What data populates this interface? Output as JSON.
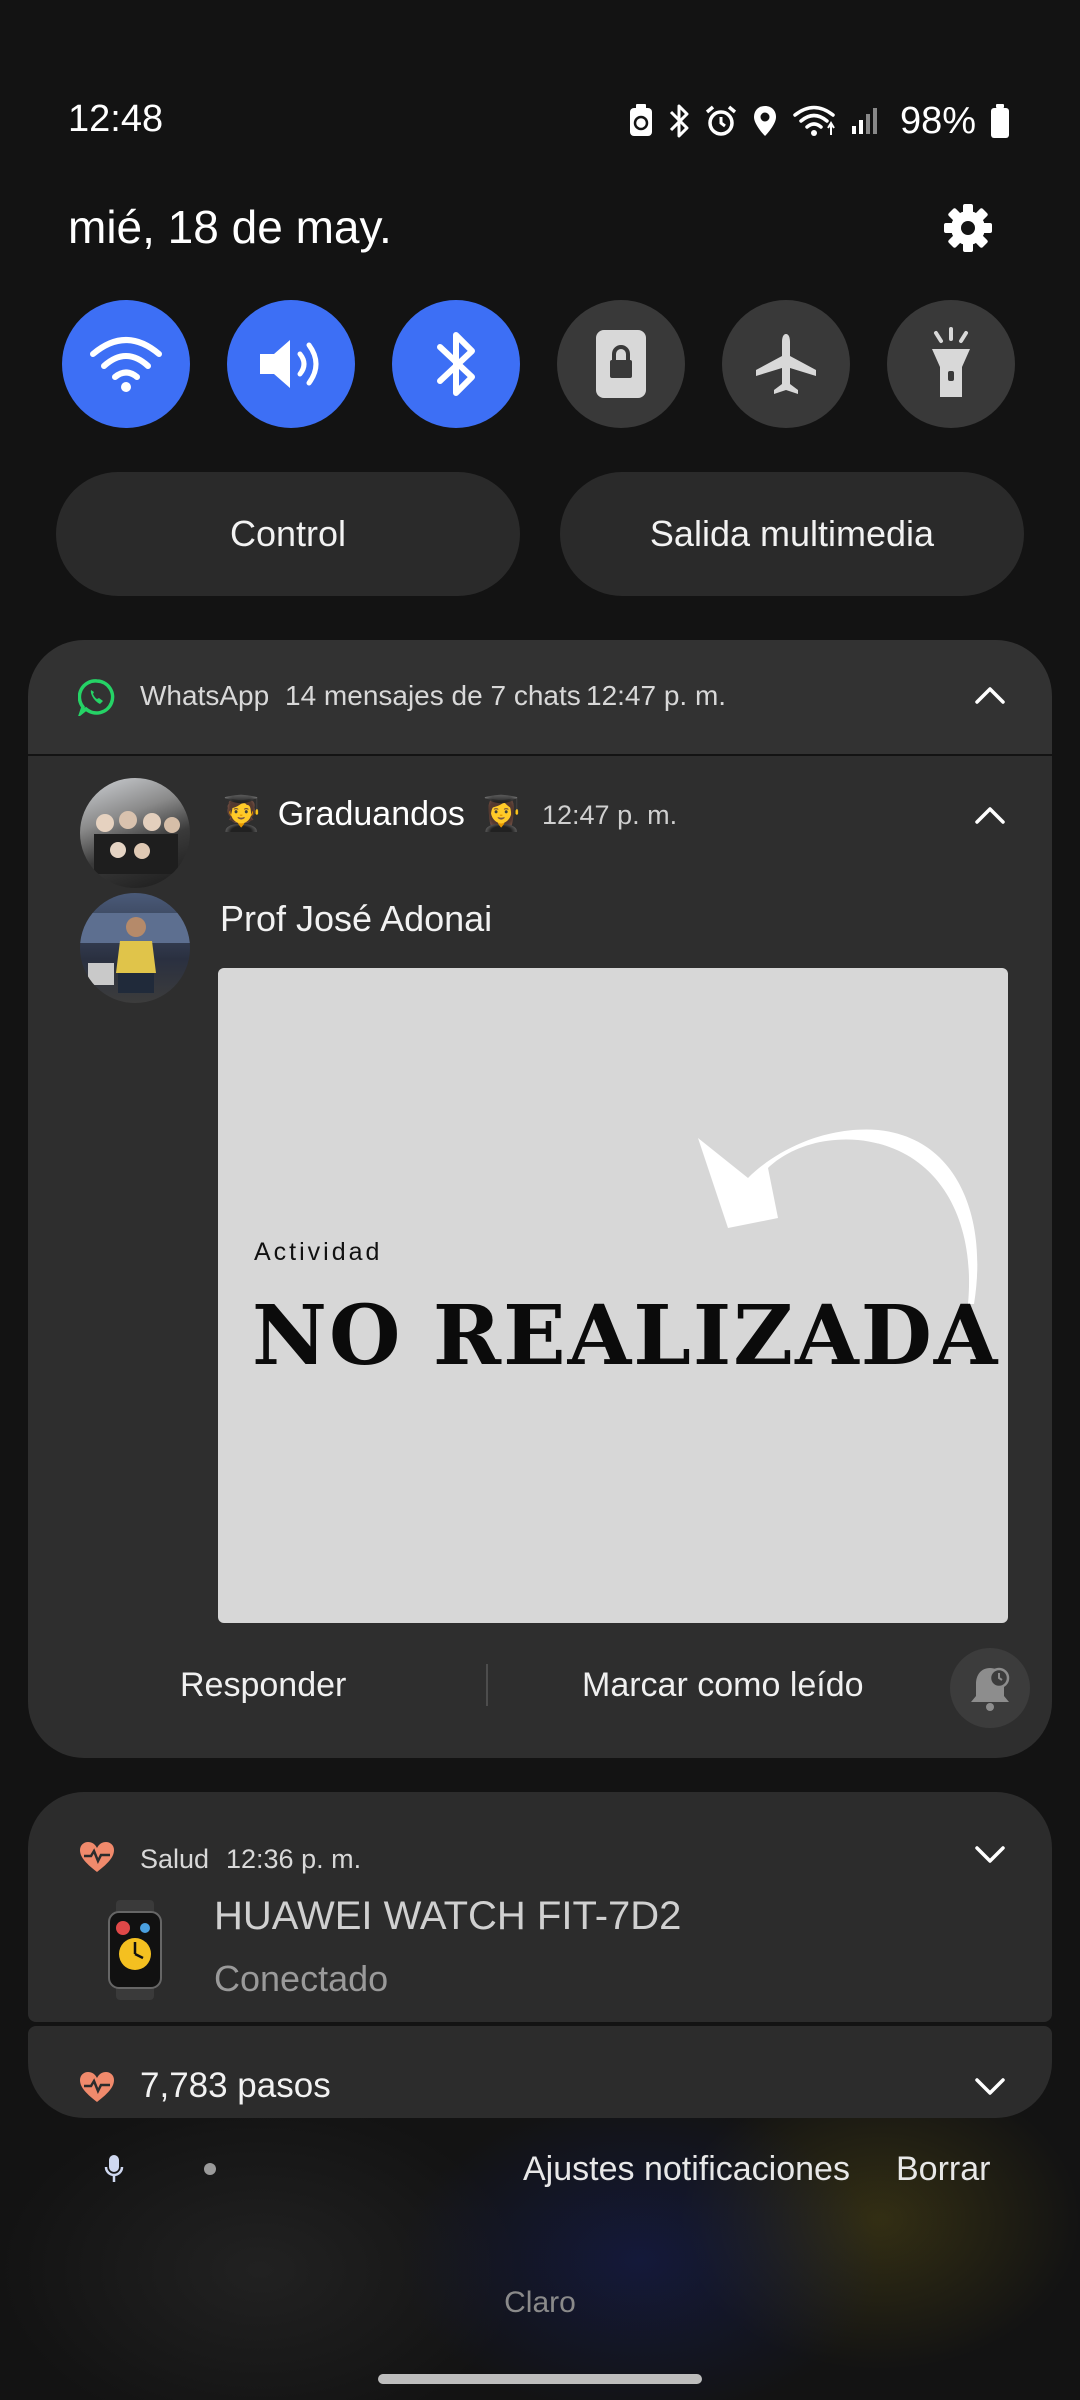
{
  "status_bar": {
    "time": "12:48",
    "battery": "98%"
  },
  "header": {
    "date": "mié, 18 de may."
  },
  "quick_settings": [
    {
      "name": "wifi",
      "icon": "wifi-icon",
      "on": true
    },
    {
      "name": "sound",
      "icon": "volume-icon",
      "on": true
    },
    {
      "name": "bluetooth",
      "icon": "bluetooth-icon",
      "on": true
    },
    {
      "name": "screen-lock",
      "icon": "lock-icon",
      "on": false
    },
    {
      "name": "airplane",
      "icon": "airplane-icon",
      "on": false
    },
    {
      "name": "flashlight",
      "icon": "flashlight-icon",
      "on": false
    }
  ],
  "pills": {
    "control": "Control",
    "media_output": "Salida multimedia"
  },
  "whatsapp": {
    "app": "WhatsApp",
    "summary": "14 mensajes de 7 chats",
    "time": "12:47 p. m.",
    "chat": {
      "title": "Graduandos",
      "emoji_left": "🧑‍🎓",
      "emoji_right": "👩‍🎓",
      "time": "12:47 p. m.",
      "sender": "Prof José Adonai",
      "image_small_text": "Actividad",
      "image_big_text": "NO REALIZADA"
    },
    "actions": {
      "reply": "Responder",
      "mark_read": "Marcar como leído"
    }
  },
  "salud": {
    "app": "Salud",
    "time": "12:36 p. m.",
    "device": "HUAWEI WATCH FIT-7D2",
    "status": "Conectado",
    "steps": "7,783 pasos"
  },
  "footer": {
    "settings": "Ajustes notificaciones",
    "clear": "Borrar",
    "carrier": "Claro"
  },
  "colors": {
    "accent": "#3d6ff5",
    "whatsapp": "#25d366",
    "health": "#f08a6c"
  }
}
